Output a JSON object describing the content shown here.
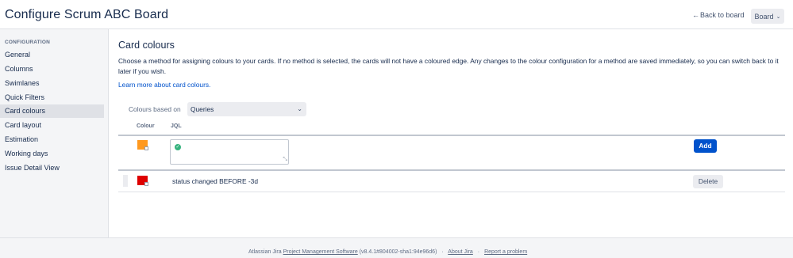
{
  "header": {
    "title": "Configure Scrum ABC Board",
    "back_label": "Back to board",
    "board_button": "Board"
  },
  "sidebar": {
    "heading": "CONFIGURATION",
    "items": [
      {
        "label": "General"
      },
      {
        "label": "Columns"
      },
      {
        "label": "Swimlanes"
      },
      {
        "label": "Quick Filters"
      },
      {
        "label": "Card colours",
        "active": true
      },
      {
        "label": "Card layout"
      },
      {
        "label": "Estimation"
      },
      {
        "label": "Working days"
      },
      {
        "label": "Issue Detail View"
      }
    ]
  },
  "main": {
    "title": "Card colours",
    "description": "Choose a method for assigning colours to your cards. If no method is selected, the cards will not have a coloured edge. Any changes to the colour configuration for a method are saved immediately, so you can switch back to it later if you wish.",
    "learn_more": "Learn more about card colours.",
    "colours_based_on_label": "Colours based on",
    "colours_based_on_value": "Queries",
    "table": {
      "col_colour": "Colour",
      "col_jql": "JQL",
      "new_row": {
        "swatch_color": "#ff991f",
        "jql_value": "",
        "add_label": "Add"
      },
      "rows": [
        {
          "swatch_color": "#de0000",
          "jql": "status changed BEFORE -3d",
          "delete_label": "Delete"
        }
      ]
    }
  },
  "footer": {
    "prefix": "Atlassian Jira",
    "pms_link": "Project Management Software",
    "version": "(v8.4.1#804002-sha1:94e96d6)",
    "about": "About Jira",
    "report": "Report a problem"
  }
}
